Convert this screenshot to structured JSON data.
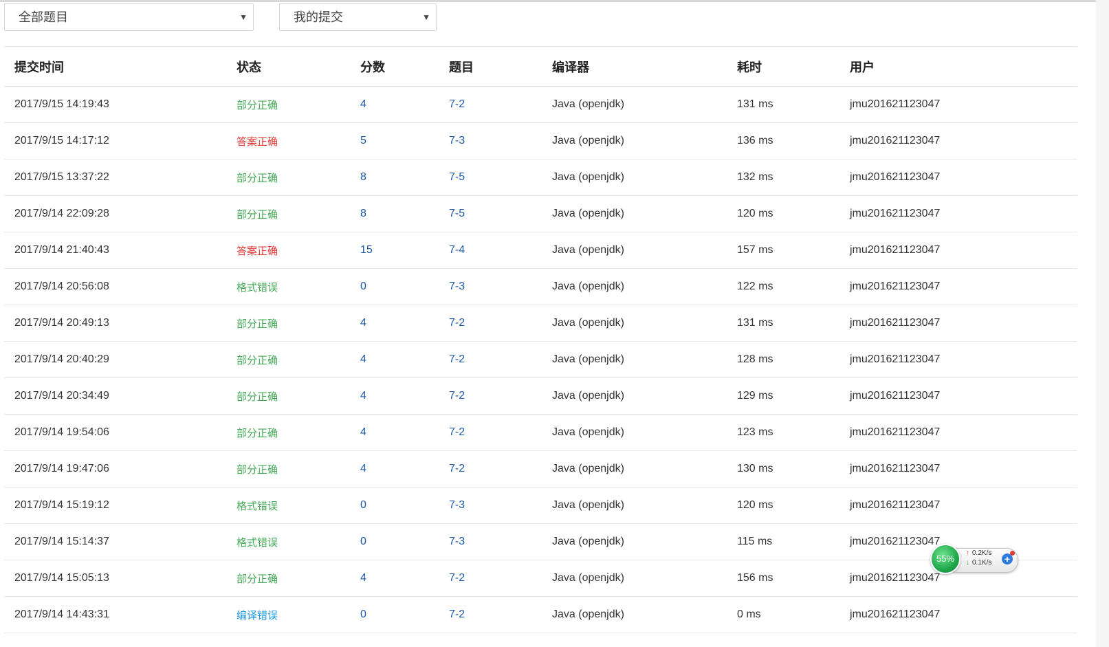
{
  "filters": {
    "problem_select": "全部题目",
    "submitter_select": "我的提交"
  },
  "table": {
    "headers": [
      "提交时间",
      "状态",
      "分数",
      "题目",
      "编译器",
      "耗时",
      "用户"
    ],
    "rows": [
      {
        "time": "2017/9/15 14:19:43",
        "status": "部分正确",
        "status_color": "#44a956",
        "score": "4",
        "problem": "7-2",
        "compiler": "Java (openjdk)",
        "cost": "131 ms",
        "user": "jmu201621123047"
      },
      {
        "time": "2017/9/15 14:17:12",
        "status": "答案正确",
        "status_color": "#e53935",
        "score": "5",
        "problem": "7-3",
        "compiler": "Java (openjdk)",
        "cost": "136 ms",
        "user": "jmu201621123047"
      },
      {
        "time": "2017/9/15 13:37:22",
        "status": "部分正确",
        "status_color": "#44a956",
        "score": "8",
        "problem": "7-5",
        "compiler": "Java (openjdk)",
        "cost": "132 ms",
        "user": "jmu201621123047"
      },
      {
        "time": "2017/9/14 22:09:28",
        "status": "部分正确",
        "status_color": "#44a956",
        "score": "8",
        "problem": "7-5",
        "compiler": "Java (openjdk)",
        "cost": "120 ms",
        "user": "jmu201621123047"
      },
      {
        "time": "2017/9/14 21:40:43",
        "status": "答案正确",
        "status_color": "#e53935",
        "score": "15",
        "problem": "7-4",
        "compiler": "Java (openjdk)",
        "cost": "157 ms",
        "user": "jmu201621123047"
      },
      {
        "time": "2017/9/14 20:56:08",
        "status": "格式错误",
        "status_color": "#44a956",
        "score": "0",
        "problem": "7-3",
        "compiler": "Java (openjdk)",
        "cost": "122 ms",
        "user": "jmu201621123047"
      },
      {
        "time": "2017/9/14 20:49:13",
        "status": "部分正确",
        "status_color": "#44a956",
        "score": "4",
        "problem": "7-2",
        "compiler": "Java (openjdk)",
        "cost": "131 ms",
        "user": "jmu201621123047"
      },
      {
        "time": "2017/9/14 20:40:29",
        "status": "部分正确",
        "status_color": "#44a956",
        "score": "4",
        "problem": "7-2",
        "compiler": "Java (openjdk)",
        "cost": "128 ms",
        "user": "jmu201621123047"
      },
      {
        "time": "2017/9/14 20:34:49",
        "status": "部分正确",
        "status_color": "#44a956",
        "score": "4",
        "problem": "7-2",
        "compiler": "Java (openjdk)",
        "cost": "129 ms",
        "user": "jmu201621123047"
      },
      {
        "time": "2017/9/14 19:54:06",
        "status": "部分正确",
        "status_color": "#44a956",
        "score": "4",
        "problem": "7-2",
        "compiler": "Java (openjdk)",
        "cost": "123 ms",
        "user": "jmu201621123047"
      },
      {
        "time": "2017/9/14 19:47:06",
        "status": "部分正确",
        "status_color": "#44a956",
        "score": "4",
        "problem": "7-2",
        "compiler": "Java (openjdk)",
        "cost": "130 ms",
        "user": "jmu201621123047"
      },
      {
        "time": "2017/9/14 15:19:12",
        "status": "格式错误",
        "status_color": "#44a956",
        "score": "0",
        "problem": "7-3",
        "compiler": "Java (openjdk)",
        "cost": "120 ms",
        "user": "jmu201621123047"
      },
      {
        "time": "2017/9/14 15:14:37",
        "status": "格式错误",
        "status_color": "#44a956",
        "score": "0",
        "problem": "7-3",
        "compiler": "Java (openjdk)",
        "cost": "115 ms",
        "user": "jmu201621123047"
      },
      {
        "time": "2017/9/14 15:05:13",
        "status": "部分正确",
        "status_color": "#44a956",
        "score": "4",
        "problem": "7-2",
        "compiler": "Java (openjdk)",
        "cost": "156 ms",
        "user": "jmu201621123047"
      },
      {
        "time": "2017/9/14 14:43:31",
        "status": "编译错误",
        "status_color": "#1e9be6",
        "score": "0",
        "problem": "7-2",
        "compiler": "Java (openjdk)",
        "cost": "0 ms",
        "user": "jmu201621123047"
      }
    ]
  },
  "speed_widget": {
    "percent": "55%",
    "upload": "0.2K/s",
    "download": "0.1K/s"
  }
}
